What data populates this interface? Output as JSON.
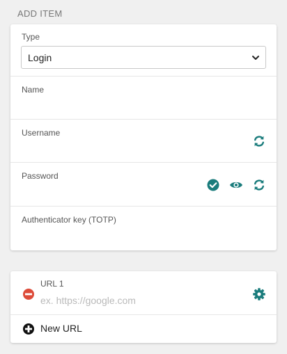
{
  "header": {
    "title": "ADD ITEM"
  },
  "form": {
    "type_label": "Type",
    "type_value": "Login",
    "name_label": "Name",
    "username_label": "Username",
    "password_label": "Password",
    "totp_label": "Authenticator key (TOTP)"
  },
  "urls": {
    "url1_label": "URL 1",
    "url1_placeholder": "ex. https://google.com",
    "new_url_label": "New URL"
  },
  "icons": {
    "username_generate": "refresh-icon",
    "password_check": "check-circle-icon",
    "password_toggle": "eye-icon",
    "password_generate": "refresh-icon",
    "remove_url": "minus-circle-icon",
    "url_settings": "gear-icon",
    "add_url": "plus-circle-icon"
  },
  "colors": {
    "accent": "#1a7c7c",
    "danger": "#dd4b39",
    "background": "#f0f0f0"
  }
}
